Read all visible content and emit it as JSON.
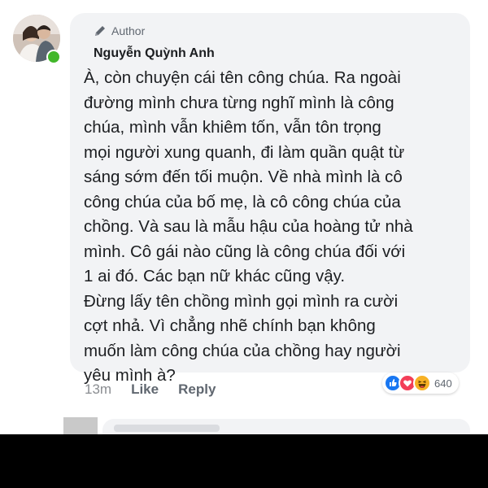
{
  "comment": {
    "author_badge": "Author",
    "author_name": "Nguyễn Quỳnh Anh",
    "text": "À, còn chuyện cái tên công chúa. Ra ngoài\nđường mình chưa từng nghĩ mình là công\nchúa, mình vẫn khiêm tốn, vẫn tôn trọng\nmọi người xung quanh, đi làm quần quật từ\nsáng sớm đến tối muộn. Về nhà mình là cô\ncông chúa của bố mẹ, là cô công chúa của\nchồng. Và sau là mẫu hậu của hoàng tử nhà\nmình. Cô gái nào cũng là công chúa đối với\n1 ai đó. Các bạn nữ khác cũng vậy.\nĐừng lấy tên chồng mình gọi mình ra cười\ncợt nhả. Vì chẳng nhẽ chính bạn không\nmuốn làm công chúa của chồng hay người\nyêu mình à?",
    "time": "13m",
    "like_label": "Like",
    "reply_label": "Reply",
    "reaction_count": "640",
    "reactions": [
      "like-icon",
      "love-icon",
      "haha-icon"
    ]
  },
  "colors": {
    "like": "#1877f2",
    "love": "#f33e58",
    "haha": "#f7b125",
    "online": "#42b72a",
    "bubble": "#f2f3f5"
  }
}
